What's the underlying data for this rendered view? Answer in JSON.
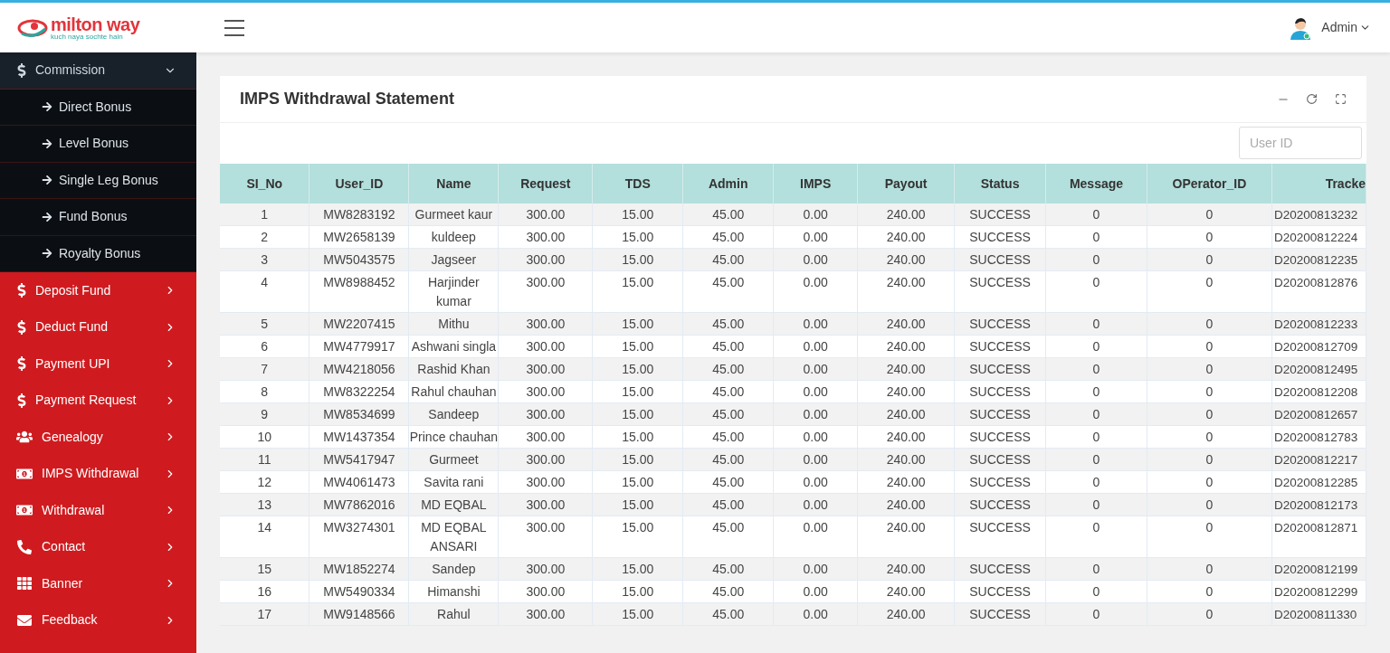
{
  "header": {
    "logo": {
      "name": "milton way",
      "tagline": "kuch naya sochte hain"
    },
    "user": {
      "name": "Admin"
    }
  },
  "sidebar": {
    "items": [
      {
        "label": "Commission",
        "expanded": true,
        "children": [
          {
            "label": "Direct Bonus"
          },
          {
            "label": "Level Bonus"
          },
          {
            "label": "Single Leg Bonus"
          },
          {
            "label": "Fund Bonus"
          },
          {
            "label": "Royalty Bonus"
          }
        ]
      },
      {
        "label": "Deposit Fund",
        "expanded": false
      },
      {
        "label": "Deduct Fund",
        "expanded": false
      },
      {
        "label": "Payment UPI",
        "expanded": false
      },
      {
        "label": "Payment Request",
        "expanded": false
      },
      {
        "label": "Genealogy",
        "expanded": false
      },
      {
        "label": "IMPS Withdrawal",
        "expanded": false
      },
      {
        "label": "Withdrawal",
        "expanded": false
      },
      {
        "label": "Contact",
        "expanded": false
      },
      {
        "label": "Banner",
        "expanded": false
      },
      {
        "label": "Feedback",
        "expanded": false
      }
    ]
  },
  "card": {
    "title": "IMPS Withdrawal Statement",
    "search": {
      "placeholder": "User ID"
    }
  },
  "table": {
    "columns": [
      "SI_No",
      "User_ID",
      "Name",
      "Request",
      "TDS",
      "Admin",
      "IMPS",
      "Payout",
      "Status",
      "Message",
      "OPerator_ID",
      "Tracke"
    ],
    "rows": [
      [
        "1",
        "MW8283192",
        "Gurmeet kaur",
        "300.00",
        "15.00",
        "45.00",
        "0.00",
        "240.00",
        "SUCCESS",
        "0",
        "0",
        "D20200813232"
      ],
      [
        "2",
        "MW2658139",
        "kuldeep",
        "300.00",
        "15.00",
        "45.00",
        "0.00",
        "240.00",
        "SUCCESS",
        "0",
        "0",
        "D20200812224"
      ],
      [
        "3",
        "MW5043575",
        "Jagseer",
        "300.00",
        "15.00",
        "45.00",
        "0.00",
        "240.00",
        "SUCCESS",
        "0",
        "0",
        "D20200812235"
      ],
      [
        "4",
        "MW8988452",
        "Harjinder kumar",
        "300.00",
        "15.00",
        "45.00",
        "0.00",
        "240.00",
        "SUCCESS",
        "0",
        "0",
        "D20200812876"
      ],
      [
        "5",
        "MW2207415",
        "Mithu",
        "300.00",
        "15.00",
        "45.00",
        "0.00",
        "240.00",
        "SUCCESS",
        "0",
        "0",
        "D20200812233"
      ],
      [
        "6",
        "MW4779917",
        "Ashwani singla",
        "300.00",
        "15.00",
        "45.00",
        "0.00",
        "240.00",
        "SUCCESS",
        "0",
        "0",
        "D20200812709"
      ],
      [
        "7",
        "MW4218056",
        "Rashid Khan",
        "300.00",
        "15.00",
        "45.00",
        "0.00",
        "240.00",
        "SUCCESS",
        "0",
        "0",
        "D20200812495"
      ],
      [
        "8",
        "MW8322254",
        "Rahul chauhan",
        "300.00",
        "15.00",
        "45.00",
        "0.00",
        "240.00",
        "SUCCESS",
        "0",
        "0",
        "D20200812208"
      ],
      [
        "9",
        "MW8534699",
        "Sandeep",
        "300.00",
        "15.00",
        "45.00",
        "0.00",
        "240.00",
        "SUCCESS",
        "0",
        "0",
        "D20200812657"
      ],
      [
        "10",
        "MW1437354",
        "Prince chauhan",
        "300.00",
        "15.00",
        "45.00",
        "0.00",
        "240.00",
        "SUCCESS",
        "0",
        "0",
        "D20200812783"
      ],
      [
        "11",
        "MW5417947",
        "Gurmeet",
        "300.00",
        "15.00",
        "45.00",
        "0.00",
        "240.00",
        "SUCCESS",
        "0",
        "0",
        "D20200812217"
      ],
      [
        "12",
        "MW4061473",
        "Savita rani",
        "300.00",
        "15.00",
        "45.00",
        "0.00",
        "240.00",
        "SUCCESS",
        "0",
        "0",
        "D20200812285"
      ],
      [
        "13",
        "MW7862016",
        "MD EQBAL",
        "300.00",
        "15.00",
        "45.00",
        "0.00",
        "240.00",
        "SUCCESS",
        "0",
        "0",
        "D20200812173"
      ],
      [
        "14",
        "MW3274301",
        "MD EQBAL ANSARI",
        "300.00",
        "15.00",
        "45.00",
        "0.00",
        "240.00",
        "SUCCESS",
        "0",
        "0",
        "D20200812871"
      ],
      [
        "15",
        "MW1852274",
        "Sandep",
        "300.00",
        "15.00",
        "45.00",
        "0.00",
        "240.00",
        "SUCCESS",
        "0",
        "0",
        "D20200812199"
      ],
      [
        "16",
        "MW5490334",
        "Himanshi",
        "300.00",
        "15.00",
        "45.00",
        "0.00",
        "240.00",
        "SUCCESS",
        "0",
        "0",
        "D20200812299"
      ],
      [
        "17",
        "MW9148566",
        "Rahul",
        "300.00",
        "15.00",
        "45.00",
        "0.00",
        "240.00",
        "SUCCESS",
        "0",
        "0",
        "D20200811330"
      ]
    ]
  }
}
